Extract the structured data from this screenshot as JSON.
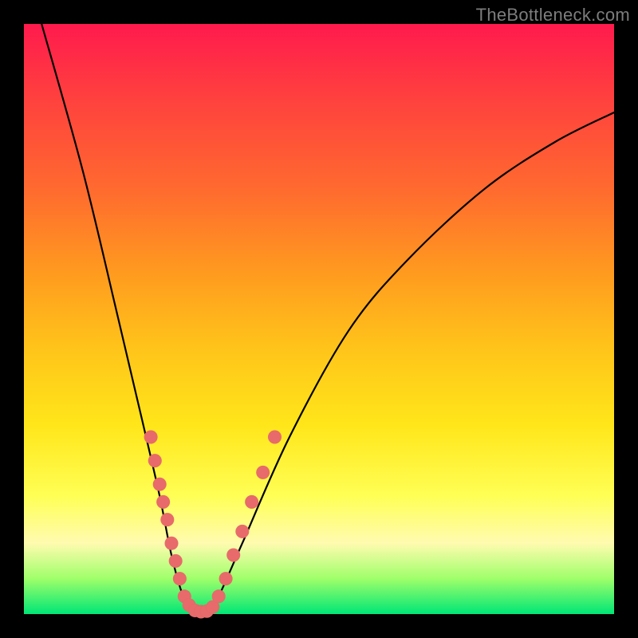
{
  "watermark": "TheBottleneck.com",
  "chart_data": {
    "type": "line",
    "title": "",
    "xlabel": "",
    "ylabel": "",
    "xlim": [
      0,
      100
    ],
    "ylim": [
      0,
      100
    ],
    "curve_points": [
      {
        "x": 3,
        "y": 100
      },
      {
        "x": 10,
        "y": 75
      },
      {
        "x": 16,
        "y": 50
      },
      {
        "x": 20,
        "y": 33
      },
      {
        "x": 23,
        "y": 20
      },
      {
        "x": 25,
        "y": 10
      },
      {
        "x": 27,
        "y": 3
      },
      {
        "x": 29,
        "y": 0
      },
      {
        "x": 31,
        "y": 0
      },
      {
        "x": 33,
        "y": 3
      },
      {
        "x": 37,
        "y": 12
      },
      {
        "x": 45,
        "y": 30
      },
      {
        "x": 55,
        "y": 48
      },
      {
        "x": 65,
        "y": 60
      },
      {
        "x": 78,
        "y": 72
      },
      {
        "x": 90,
        "y": 80
      },
      {
        "x": 100,
        "y": 85
      }
    ],
    "series": [
      {
        "name": "sample-points",
        "points": [
          {
            "x": 21.5,
            "y": 30
          },
          {
            "x": 22.2,
            "y": 26
          },
          {
            "x": 23.0,
            "y": 22
          },
          {
            "x": 23.6,
            "y": 19
          },
          {
            "x": 24.3,
            "y": 16
          },
          {
            "x": 25.0,
            "y": 12
          },
          {
            "x": 25.7,
            "y": 9
          },
          {
            "x": 26.4,
            "y": 6
          },
          {
            "x": 27.2,
            "y": 3
          },
          {
            "x": 28.0,
            "y": 1.5
          },
          {
            "x": 29.0,
            "y": 0.6
          },
          {
            "x": 30.0,
            "y": 0.4
          },
          {
            "x": 31.0,
            "y": 0.5
          },
          {
            "x": 32.0,
            "y": 1.2
          },
          {
            "x": 33.0,
            "y": 3
          },
          {
            "x": 34.2,
            "y": 6
          },
          {
            "x": 35.5,
            "y": 10
          },
          {
            "x": 37.0,
            "y": 14
          },
          {
            "x": 38.6,
            "y": 19
          },
          {
            "x": 40.5,
            "y": 24
          },
          {
            "x": 42.5,
            "y": 30
          }
        ]
      }
    ],
    "colors": {
      "curve": "#000000",
      "dots": "#e86a6a",
      "gradient_top": "#ff1a4d",
      "gradient_bottom": "#00e676"
    }
  }
}
